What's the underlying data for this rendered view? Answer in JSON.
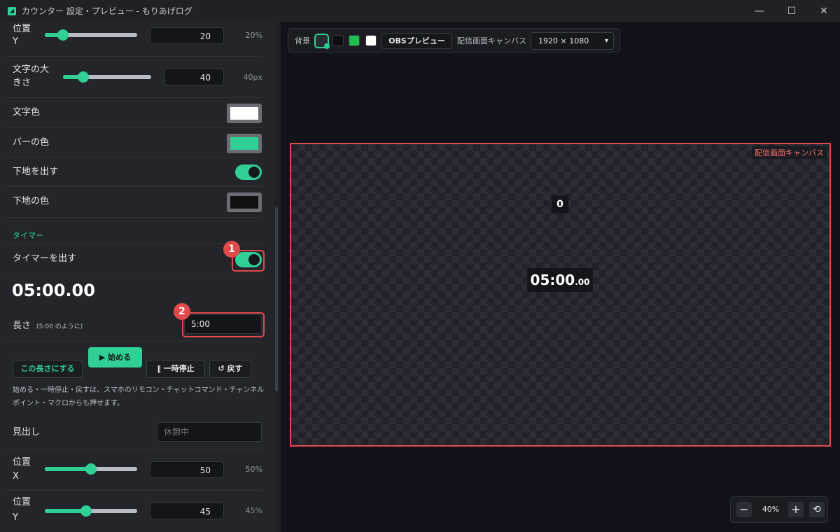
{
  "window": {
    "title": "カウンター 設定・プレビュー - もりあげログ",
    "min": "—",
    "max": "☐",
    "close": "✕"
  },
  "panel": {
    "pos_y_top": {
      "label1": "位置",
      "label2": "Y",
      "value": "20",
      "pct": "20%",
      "level": 0.2
    },
    "font_size": {
      "label1": "文字の大",
      "label2": "きさ",
      "value": "40",
      "pct": "40px",
      "level": 0.23
    },
    "text_color": {
      "label": "文字色",
      "color": "#ffffff"
    },
    "bar_color": {
      "label": "バーの色",
      "color": "#2fcf96"
    },
    "bg_toggle": {
      "label": "下地を出す",
      "on": true
    },
    "bg_color": {
      "label": "下地の色",
      "color": "#111111"
    },
    "timer_section": "タイマー",
    "timer_toggle": {
      "label": "タイマーを出す",
      "on": true
    },
    "big_time": "05:00.00",
    "duration": {
      "label": "長さ",
      "hint": "(5:00 のように)",
      "value": "5:00"
    },
    "buttons": {
      "set": "この長さにする",
      "start": "▶ 始める",
      "pause": "‖ 一時停止",
      "reset": "↺ 戻す"
    },
    "note": "始める・一時停止・戻すは、スマホのリモコン・チャットコマンド・チャンネルポイント・マクロからも押せます。",
    "heading": {
      "label": "見出し",
      "placeholder": "休憩中"
    },
    "pos_x": {
      "label1": "位置",
      "label2": "X",
      "value": "50",
      "pct": "50%",
      "level": 0.5
    },
    "pos_y": {
      "label1": "位置",
      "label2": "Y",
      "value": "45",
      "pct": "45%",
      "level": 0.45
    },
    "annotations": [
      "1",
      "2"
    ]
  },
  "preview": {
    "bg_label": "背景",
    "bg_swatches": [
      "#2b2c33",
      "#0d0d10",
      "#1fbf4f",
      "#ffffff"
    ],
    "obs_button": "OBSプレビュー",
    "canvas_label": "配信画面キャンバス",
    "resolution": "1920 × 1080",
    "canvas_tag": "配信画面キャンバス",
    "count_value": "0",
    "timer_main": "05:00",
    "timer_frac": ".00",
    "zoom": {
      "minus": "−",
      "value": "40%",
      "plus": "+",
      "reset": "⟲"
    }
  },
  "colors": {
    "accent": "#2fcf96",
    "highlight": "#e04a4a"
  }
}
